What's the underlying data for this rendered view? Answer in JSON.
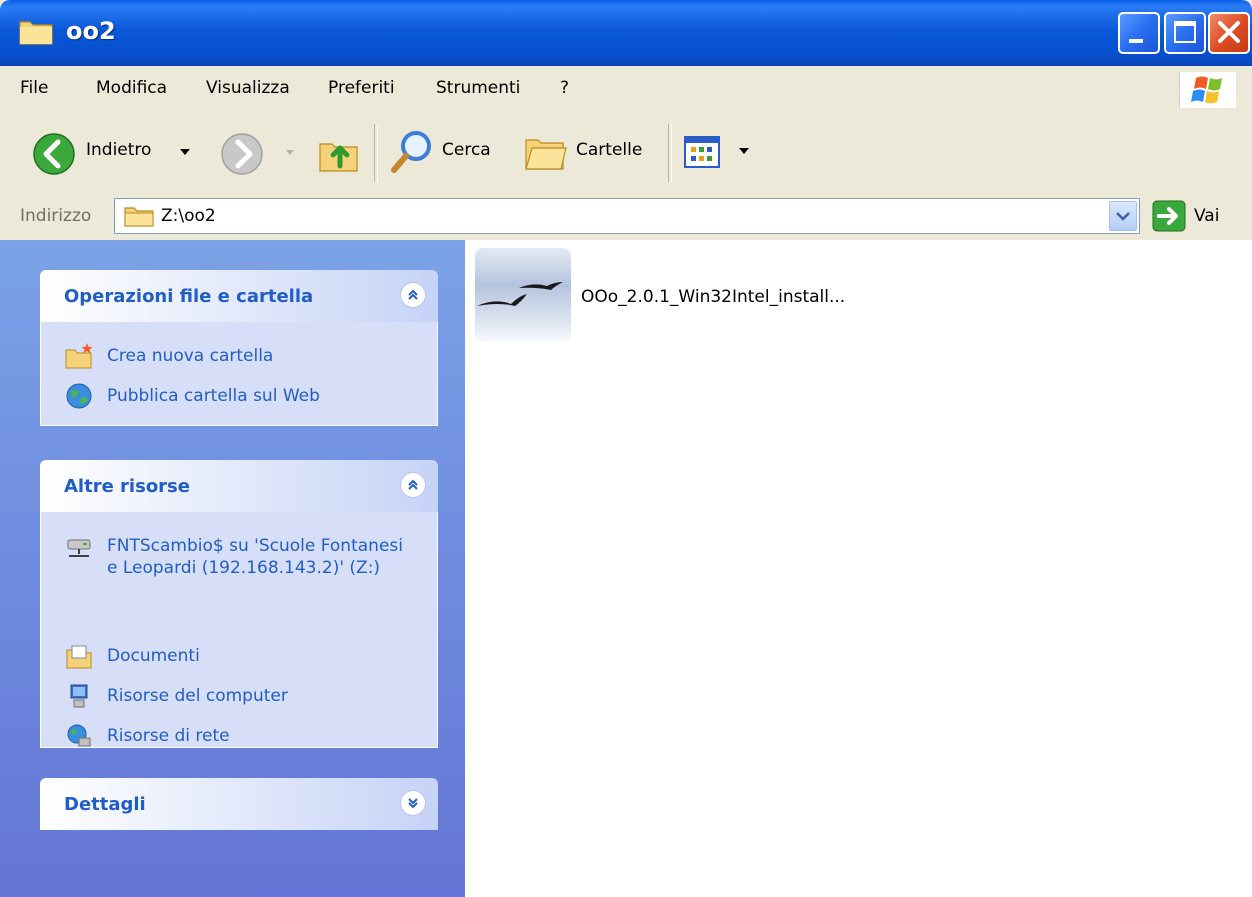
{
  "window": {
    "title": "oo2"
  },
  "menu": [
    "File",
    "Modifica",
    "Visualizza",
    "Preferiti",
    "Strumenti",
    "?"
  ],
  "toolbar": {
    "back_label": "Indietro",
    "search_label": "Cerca",
    "folders_label": "Cartelle"
  },
  "address": {
    "label": "Indirizzo",
    "value": "Z:\\oo2",
    "go_label": "Vai"
  },
  "panels": {
    "file_tasks": {
      "title": "Operazioni file e cartella",
      "items": [
        "Crea nuova cartella",
        "Pubblica cartella sul Web"
      ]
    },
    "other_places": {
      "title": "Altre risorse",
      "items": [
        "FNTScambio$ su 'Scuole Fontanesi e Leopardi (192.168.143.2)' (Z:)",
        "Documenti",
        "Risorse del computer",
        "Risorse di rete"
      ]
    },
    "details": {
      "title": "Dettagli"
    }
  },
  "files": [
    {
      "name": "OOo_2.0.1_Win32Intel_install...",
      "icon": "openoffice-installer-icon"
    }
  ],
  "colors": {
    "titlebar": "#0a58d8",
    "panel_bg": "#6375d6",
    "link": "#215dc6"
  }
}
